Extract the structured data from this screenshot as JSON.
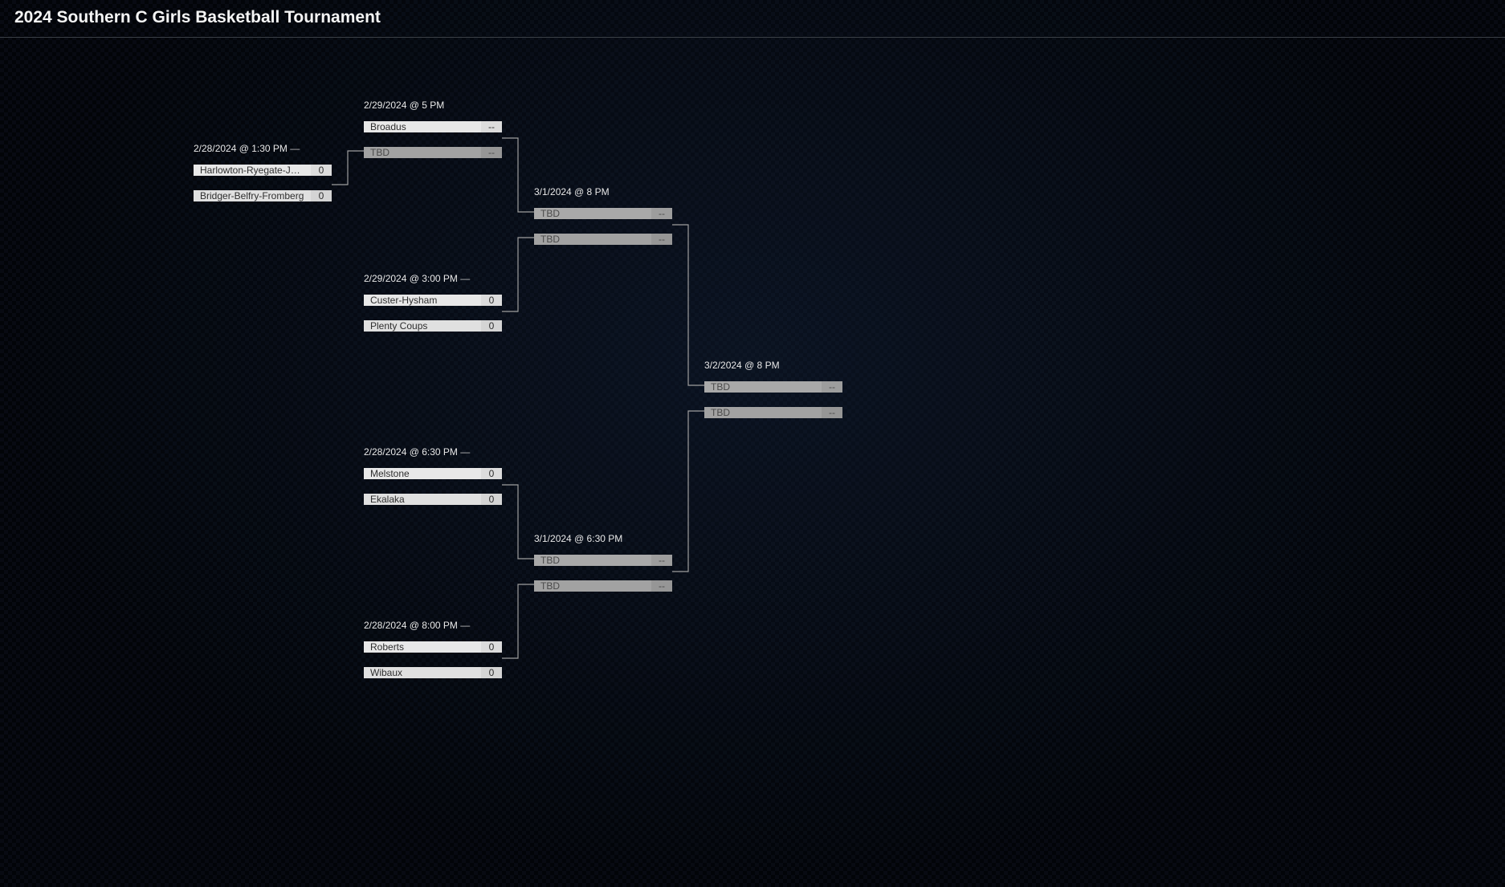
{
  "title": "2024 Southern C Girls Basketball Tournament",
  "matches": {
    "m1": {
      "label": "2/28/2024 @ 1:30 PM",
      "dash": true,
      "team1": "Harlowton-Ryegate-Judith",
      "score1": "0",
      "team2": "Bridger-Belfry-Fromberg",
      "score2": "0",
      "tbd1": false,
      "tbd2": false
    },
    "m2": {
      "label": "2/29/2024 @ 5 PM",
      "dash": false,
      "team1": "Broadus",
      "score1": "--",
      "team2": "TBD",
      "score2": "--",
      "tbd1": false,
      "tbd2": true
    },
    "m3": {
      "label": "2/29/2024 @ 3:00 PM",
      "dash": true,
      "team1": "Custer-Hysham",
      "score1": "0",
      "team2": "Plenty Coups",
      "score2": "0",
      "tbd1": false,
      "tbd2": false
    },
    "m4": {
      "label": "3/1/2024 @ 8 PM",
      "dash": false,
      "team1": "TBD",
      "score1": "--",
      "team2": "TBD",
      "score2": "--",
      "tbd1": true,
      "tbd2": true
    },
    "m5": {
      "label": "2/28/2024 @ 6:30 PM",
      "dash": true,
      "team1": "Melstone",
      "score1": "0",
      "team2": "Ekalaka",
      "score2": "0",
      "tbd1": false,
      "tbd2": false
    },
    "m6": {
      "label": "2/28/2024 @ 8:00 PM",
      "dash": true,
      "team1": "Roberts",
      "score1": "0",
      "team2": "Wibaux",
      "score2": "0",
      "tbd1": false,
      "tbd2": false
    },
    "m7": {
      "label": "3/1/2024 @ 6:30 PM",
      "dash": false,
      "team1": "TBD",
      "score1": "--",
      "team2": "TBD",
      "score2": "--",
      "tbd1": true,
      "tbd2": true
    },
    "m8": {
      "label": "3/2/2024 @ 8 PM",
      "dash": false,
      "team1": "TBD",
      "score1": "--",
      "team2": "TBD",
      "score2": "--",
      "tbd1": true,
      "tbd2": true
    }
  }
}
